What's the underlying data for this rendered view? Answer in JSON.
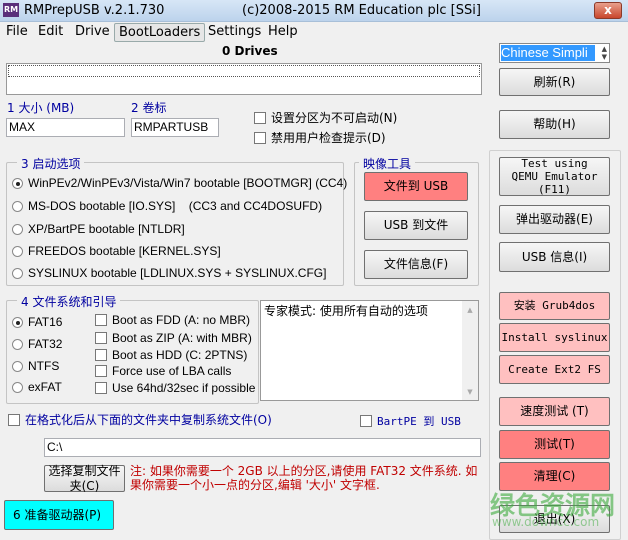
{
  "window": {
    "title": "RMPrepUSB v.2.1.730",
    "copyright": "(c)2008-2015 RM Education plc [SSi]",
    "logo": "RM",
    "close": "x"
  },
  "menu": [
    "File",
    "Edit",
    "Drive",
    "BootLoaders",
    "Settings",
    "Help"
  ],
  "drives": {
    "count_label": "0 Drives"
  },
  "language": {
    "selected": "Chinese Simpli"
  },
  "size": {
    "label": "1 大小 (MB)",
    "value": "MAX"
  },
  "volume": {
    "label": "2 卷标",
    "value": "RMPARTUSB"
  },
  "checks": {
    "non_bootable": "设置分区为不可启动(N)",
    "no_prompt": "禁用用户检查提示(D)"
  },
  "boot_options": {
    "title": "3 启动选项",
    "items": [
      {
        "label": "WinPEv2/WinPEv3/Vista/Win7 bootable [BOOTMGR] (CC4)",
        "selected": true
      },
      {
        "label": "MS-DOS bootable [IO.SYS]    (CC3 and CC4DOSUFD)",
        "selected": false
      },
      {
        "label": "XP/BartPE bootable [NTLDR]",
        "selected": false
      },
      {
        "label": "FREEDOS bootable [KERNEL.SYS]",
        "selected": false
      },
      {
        "label": "SYSLINUX bootable [LDLINUX.SYS + SYSLINUX.CFG]",
        "selected": false
      }
    ]
  },
  "image_tools": {
    "title": "映像工具",
    "file_to_usb": "文件到 USB",
    "usb_to_file": "USB 到文件",
    "file_info": "文件信息(F)"
  },
  "filesystem": {
    "title": "4 文件系统和引导",
    "fs": [
      {
        "label": "FAT16",
        "selected": true
      },
      {
        "label": "FAT32",
        "selected": false
      },
      {
        "label": "NTFS",
        "selected": false
      },
      {
        "label": "exFAT",
        "selected": false
      }
    ],
    "options": [
      "Boot as FDD (A: no MBR)",
      "Boot as ZIP (A: with MBR)",
      "Boot as HDD (C: 2PTNS)",
      "Force use of LBA calls",
      "Use 64hd/32sec if possible"
    ]
  },
  "expert_text": "专家模式: 使用所有自动的选项",
  "copy_files": {
    "label": "在格式化后从下面的文件夹中复制系统文件(O)",
    "bartpe": "BartPE 到 USB",
    "path": "C:\\",
    "choose_button": "选择复制文件夹(C)"
  },
  "note": "注: 如果你需要一个 2GB 以上的分区,请使用 FAT32 文件系统. 如果你需要一个小一点的分区,编辑 '大小' 文字框.",
  "prepare_button": "6 准备驱动器(P)",
  "right_buttons": {
    "refresh": "刷新(R)",
    "help": "帮助(H)",
    "qemu": "Test using QEMU Emulator (F11)",
    "eject": "弹出驱动器(E)",
    "usb_info": "USB 信息(I)",
    "grub4dos": "安装 Grub4dos",
    "syslinux": "Install syslinux",
    "ext2": "Create Ext2 FS",
    "speed": "速度测试 (T)",
    "test": "测试(T)",
    "clean": "清理(C)",
    "exit": "退出(X)"
  },
  "watermark": {
    "name": "绿色资源网",
    "url": "www.downcc.com"
  },
  "colors": {
    "pink": "#ffc0c0",
    "red": "#ff8080",
    "cyan": "#00ffff",
    "label_blue": "#0000a0",
    "note_red": "#c00000"
  }
}
